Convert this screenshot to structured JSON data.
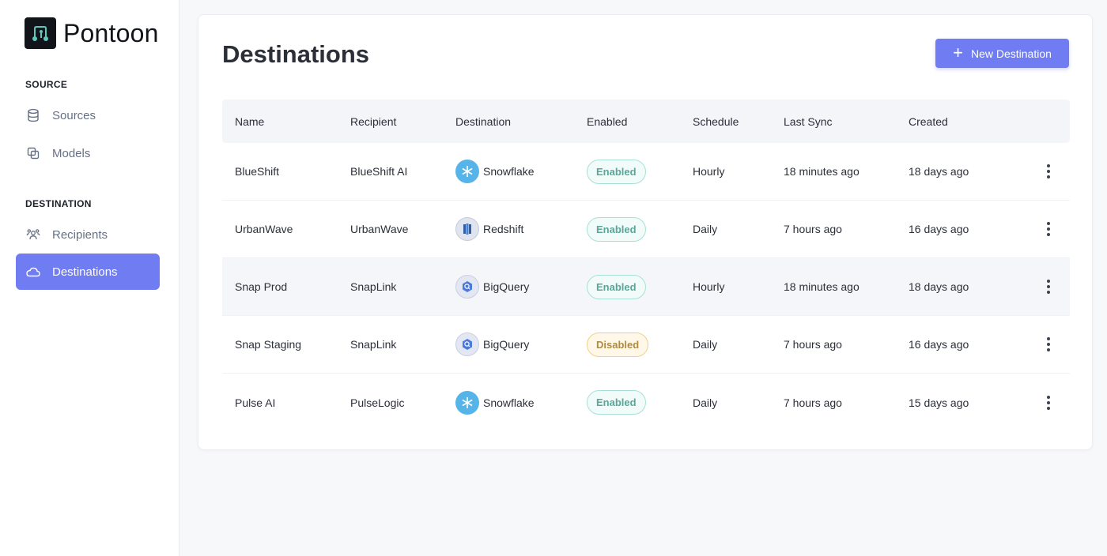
{
  "brand": {
    "name": "Pontoon",
    "logo_icon": "pontoon-logo-icon"
  },
  "sidebar": {
    "sections": [
      {
        "label": "SOURCE",
        "items": [
          {
            "label": "Sources",
            "icon": "database-icon"
          },
          {
            "label": "Models",
            "icon": "copy-icon"
          }
        ]
      },
      {
        "label": "DESTINATION",
        "items": [
          {
            "label": "Recipients",
            "icon": "users-icon"
          },
          {
            "label": "Destinations",
            "icon": "cloud-icon",
            "active": true
          }
        ]
      }
    ]
  },
  "main": {
    "title": "Destinations",
    "new_button_label": "New Destination",
    "table": {
      "headers": {
        "name": "Name",
        "recipient": "Recipient",
        "destination": "Destination",
        "enabled": "Enabled",
        "schedule": "Schedule",
        "last_sync": "Last Sync",
        "created": "Created"
      },
      "rows": [
        {
          "name": "BlueShift",
          "recipient": "BlueShift AI",
          "destination": "Snowflake",
          "dest_icon": "snowflake-icon",
          "enabled": "Enabled",
          "schedule": "Hourly",
          "last_sync": "18 minutes ago",
          "created": "18 days ago"
        },
        {
          "name": "UrbanWave",
          "recipient": "UrbanWave",
          "destination": "Redshift",
          "dest_icon": "redshift-icon",
          "enabled": "Enabled",
          "schedule": "Daily",
          "last_sync": "7 hours ago",
          "created": "16 days ago"
        },
        {
          "name": "Snap Prod",
          "recipient": "SnapLink",
          "destination": "BigQuery",
          "dest_icon": "bigquery-icon",
          "enabled": "Enabled",
          "schedule": "Hourly",
          "last_sync": "18 minutes ago",
          "created": "18 days ago"
        },
        {
          "name": "Snap Staging",
          "recipient": "SnapLink",
          "destination": "BigQuery",
          "dest_icon": "bigquery-icon",
          "enabled": "Disabled",
          "schedule": "Daily",
          "last_sync": "7 hours ago",
          "created": "16 days ago"
        },
        {
          "name": "Pulse AI",
          "recipient": "PulseLogic",
          "destination": "Snowflake",
          "dest_icon": "snowflake-icon",
          "enabled": "Enabled",
          "schedule": "Daily",
          "last_sync": "7 hours ago",
          "created": "15 days ago"
        }
      ]
    }
  },
  "colors": {
    "accent": "#6f7cf2",
    "enabled_text": "#5aa79a",
    "disabled_text": "#b08a3e",
    "snowflake": "#56b4e9",
    "redshift": "#2f5fa8",
    "bigquery": "#4a7bdc"
  }
}
